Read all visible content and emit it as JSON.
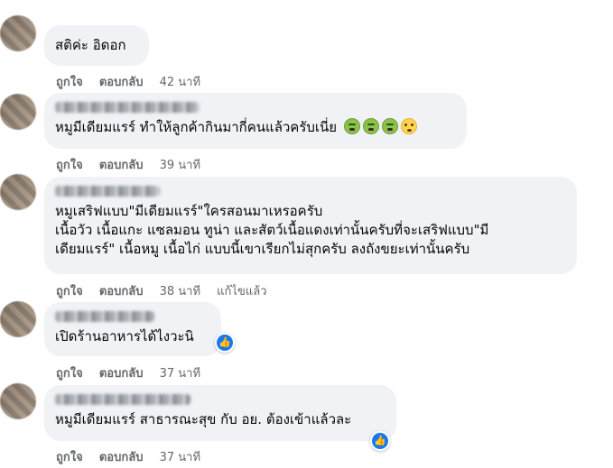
{
  "header": {
    "truncated_text": "·· ··· ··· ·· ·· ··"
  },
  "comments": [
    {
      "text_lines": [
        "สติค่ะ อิดอก"
      ],
      "actions": {
        "like": "ถูกใจ",
        "reply": "ตอบกลับ",
        "time": "42 นาที"
      }
    },
    {
      "text_lines": [
        "หมูมีเดียมแรร์ ทำให้ลูกค้ากินมากี่คนแล้วครับเนี่ย"
      ],
      "emojis": [
        "sick-face",
        "sick-face",
        "sick-face",
        "flushed-face"
      ],
      "actions": {
        "like": "ถูกใจ",
        "reply": "ตอบกลับ",
        "time": "39 นาที"
      }
    },
    {
      "text_lines": [
        "หมูเสริฟแบบ\"มีเดียมแรร์\"ใครสอนมาเหรอครับ",
        "เนื้อวัว เนื้อแกะ แซลมอน ทูน่า และสัตว์เนื้อแดงเท่านั้นครับที่จะเสริฟแบบ\"มี",
        "เดียมแรร์\" เนื้อหมู เนื้อไก่ แบบนี้เขาเรียกไม่สุกครับ ลงถังขยะเท่านั้นครับ"
      ],
      "actions": {
        "like": "ถูกใจ",
        "reply": "ตอบกลับ",
        "time": "38 นาที",
        "edited": "แก้ไขแล้ว"
      }
    },
    {
      "text_lines": [
        "เปิดร้านอาหารได้ไงวะนิ"
      ],
      "reaction": "like",
      "actions": {
        "like": "ถูกใจ",
        "reply": "ตอบกลับ",
        "time": "37 นาที"
      }
    },
    {
      "text_lines": [
        "หมูมีเดียมแรร์ สาธารณะสุข กับ อย. ต้องเข้าแล้วละ"
      ],
      "reaction": "like",
      "actions": {
        "like": "ถูกใจ",
        "reply": "ตอบกลับ",
        "time": "37 นาที"
      }
    }
  ],
  "colors": {
    "bubble": "#f0f2f5",
    "meta_text": "#65676b",
    "like_blue": "#1877f2"
  }
}
